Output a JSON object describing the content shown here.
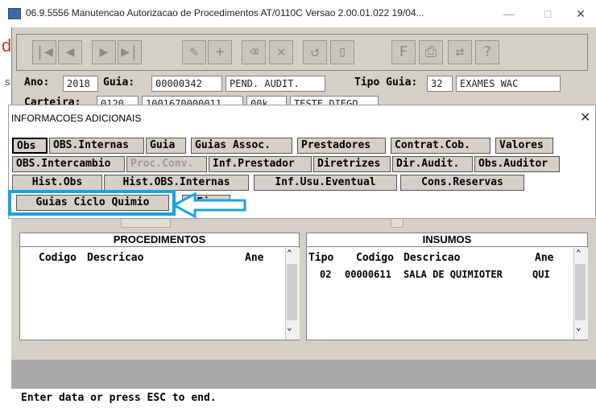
{
  "window": {
    "title": "06.9.5556 Manutencao Autorizacao de Procedimentos AT/0110C Versao 2.00.01.022 19/04...",
    "minimize": "—",
    "maximize": "□",
    "close": "✕"
  },
  "left_deco": {
    "char": "d",
    "char2": "s"
  },
  "toolbar": {
    "buttons": [
      "first-icon",
      "prev-icon",
      "next-icon",
      "last-icon",
      "edit-icon",
      "add-icon",
      "delete-icon",
      "cancel-icon",
      "undo-icon",
      "exit-door-icon",
      "filter-icon",
      "print-icon",
      "navigate-icon",
      "help-icon"
    ]
  },
  "header": {
    "ano_label": "Ano:",
    "ano_value": "2018",
    "guia_label": "Guia:",
    "guia_value": "00000342",
    "status_value": "PEND. AUDIT.",
    "tipo_label": "Tipo Guia:",
    "tipo_value": "32",
    "tipo_desc": "EXAMES WAC",
    "carteira_label": "Carteira:",
    "carteira_1": "0120",
    "carteira_2": "1001670000011",
    "carteira_3": "00k",
    "carteira_4": "TESTE DIEGO"
  },
  "dialog": {
    "title": "INFORMACOES ADICIONAIS",
    "close": "✕",
    "row1": [
      "Obs",
      "OBS.Internas",
      "Guia",
      "Guias Assoc.",
      "Prestadores",
      "Contrat.Cob.",
      "Valores"
    ],
    "row2": [
      "OBS.Intercambio",
      "Proc.Conv.",
      "Inf.Prestador",
      "Diretrizes",
      "Dir.Audit.",
      "Obs.Auditor"
    ],
    "row3": [
      "Hist.Obs",
      "Hist.OBS.Internas",
      "Inf.Usu.Eventual",
      "Cons.Reservas"
    ],
    "row4": [
      "Guias Ciclo Quimio",
      "Fim"
    ]
  },
  "procedimentos": {
    "title": "PROCEDIMENTOS",
    "col_codigo": "Codigo",
    "col_descricao": "Descricao",
    "col_ane": "Ane"
  },
  "insumos": {
    "title": "INSUMOS",
    "col_tipo": "Tipo",
    "col_codigo": "Codigo",
    "col_descricao": "Descricao",
    "col_ane": "Ane",
    "rows": [
      {
        "tipo": "02",
        "codigo": "00000611",
        "descricao": "SALA DE QUIMIOTER",
        "ane": "QUI"
      }
    ]
  },
  "status_bar": "Enter data or press ESC to end.",
  "colors": {
    "highlight": "#1aa2e0",
    "panel_bg": "#d4d0c8"
  }
}
